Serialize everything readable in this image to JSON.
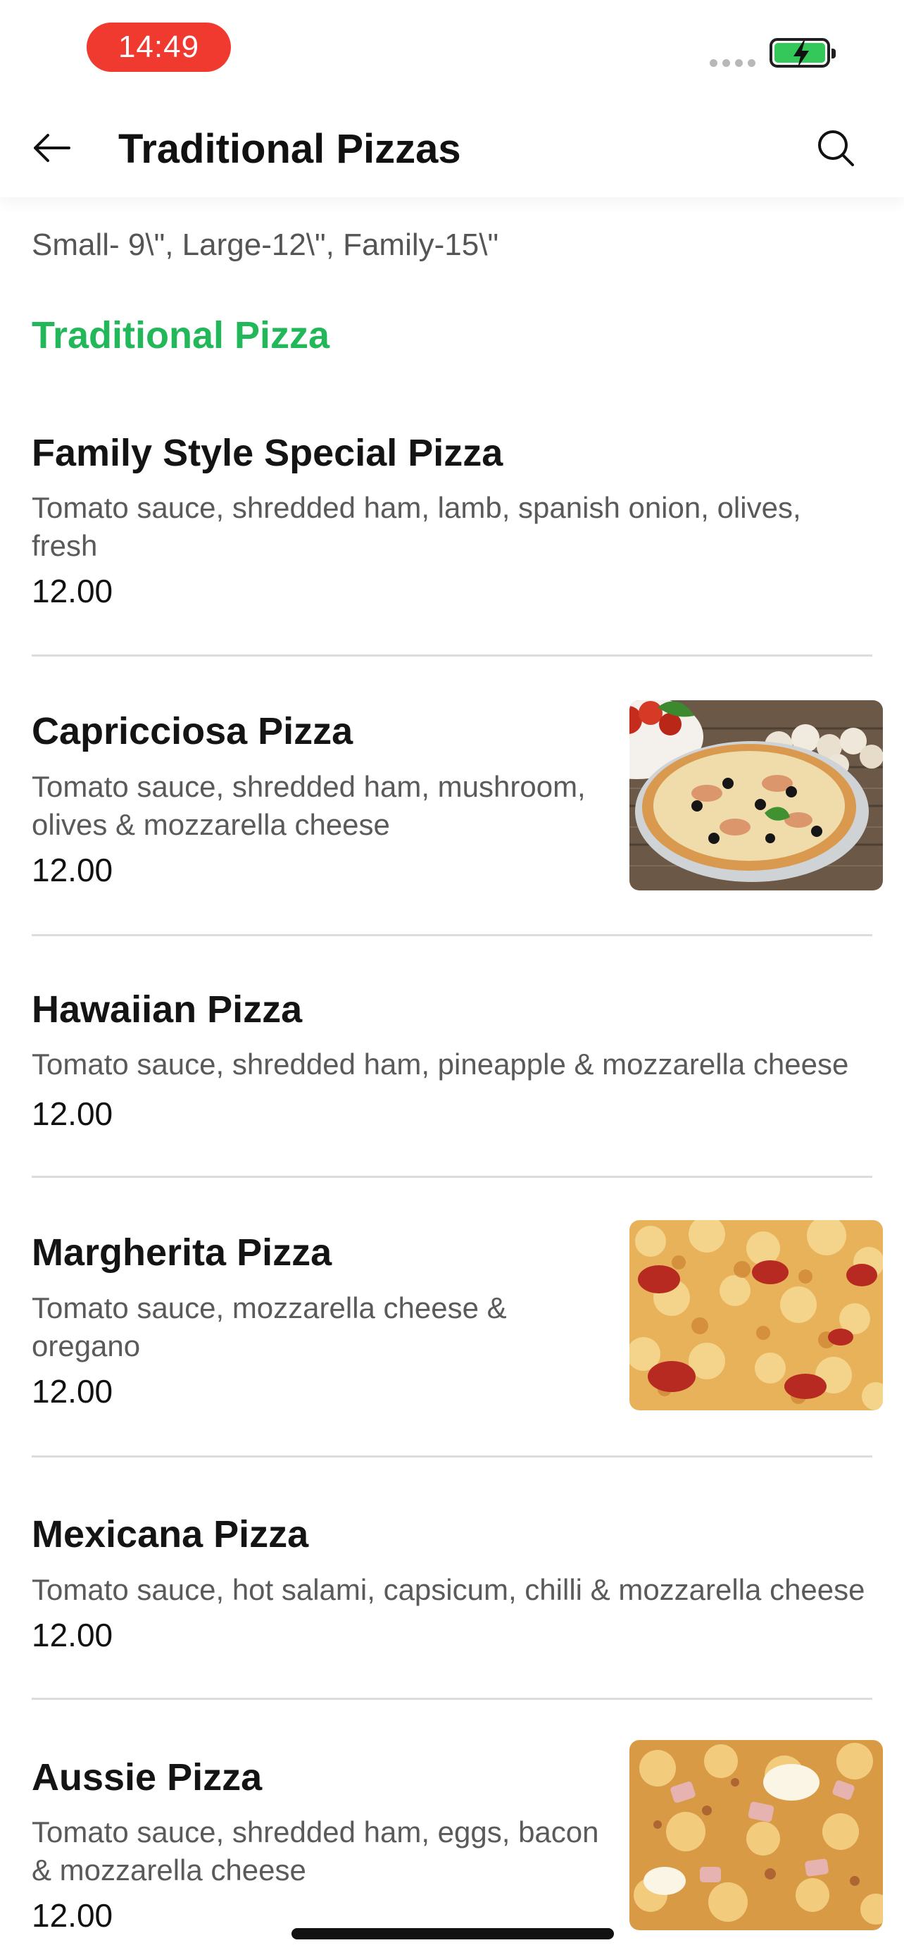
{
  "status_bar": {
    "time": "14:49"
  },
  "header": {
    "title": "Traditional Pizzas"
  },
  "size_note": "Small- 9\\\", Large-12\\\", Family-15\\\"",
  "section_title": "Traditional Pizza",
  "items": [
    {
      "name": "Family Style Special Pizza",
      "desc": "Tomato sauce, shredded ham, lamb, spanish onion, olives, fresh",
      "price": "12.00"
    },
    {
      "name": "Capricciosa Pizza",
      "desc": "Tomato sauce, shredded ham, mushroom, olives & mozzarella cheese",
      "price": "12.00"
    },
    {
      "name": "Hawaiian Pizza",
      "desc": "Tomato sauce, shredded ham, pineapple & mozzarella cheese",
      "price": "12.00"
    },
    {
      "name": "Margherita Pizza",
      "desc": "Tomato sauce, mozzarella cheese & oregano",
      "price": "12.00"
    },
    {
      "name": "Mexicana Pizza",
      "desc": "Tomato sauce, hot salami, capsicum, chilli & mozzarella cheese",
      "price": "12.00"
    },
    {
      "name": "Aussie Pizza",
      "desc": "Tomato sauce, shredded ham, eggs, bacon & mozzarella cheese",
      "price": "12.00"
    }
  ],
  "colors": {
    "accent": "#22b85a",
    "time_pill": "#f03a30",
    "battery": "#34c759"
  }
}
